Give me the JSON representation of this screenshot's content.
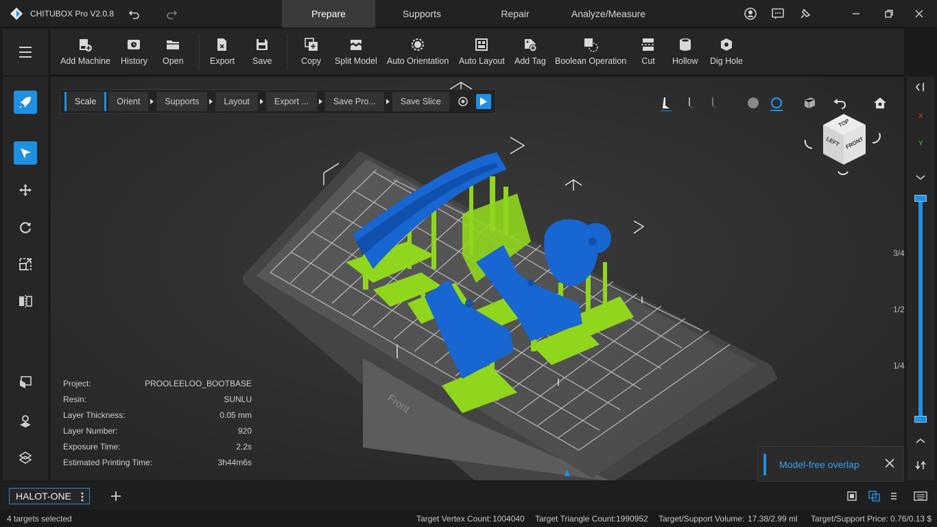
{
  "app": {
    "title": "CHITUBOX Pro V2.0.8",
    "logo_icon": "chitubox-logo-icon",
    "accent": "#1e8fe1"
  },
  "tabs": [
    {
      "label": "Prepare",
      "active": true
    },
    {
      "label": "Supports",
      "active": false
    },
    {
      "label": "Repair",
      "active": false
    },
    {
      "label": "Analyze/Measure",
      "active": false
    }
  ],
  "toolbar": [
    {
      "label": "Add Machine",
      "icon": "add-machine-icon"
    },
    {
      "label": "History",
      "icon": "history-icon"
    },
    {
      "label": "Open",
      "icon": "folder-open-icon"
    },
    {
      "label": "Export",
      "icon": "export-icon"
    },
    {
      "label": "Save",
      "icon": "save-icon"
    },
    {
      "label": "Copy",
      "icon": "copy-icon"
    },
    {
      "label": "Split Model",
      "icon": "split-model-icon"
    },
    {
      "label": "Auto Orientation",
      "icon": "auto-orientation-icon"
    },
    {
      "label": "Auto Layout",
      "icon": "auto-layout-icon"
    },
    {
      "label": "Add Tag",
      "icon": "add-tag-icon"
    },
    {
      "label": "Boolean Operation",
      "icon": "boolean-icon"
    },
    {
      "label": "Cut",
      "icon": "cut-icon"
    },
    {
      "label": "Hollow",
      "icon": "hollow-icon"
    },
    {
      "label": "Dig Hole",
      "icon": "dig-hole-icon"
    }
  ],
  "workflow": [
    "Scale",
    "Orient",
    "Supports",
    "Layout",
    "Export ...",
    "Save Pro...",
    "Save Slice"
  ],
  "info": {
    "project_label": "Project:",
    "project": "PROOLEELOO_BOOTBASE",
    "resin_label": "Resin:",
    "resin": "SUNLU",
    "layer_thickness_label": "Layer Thickness:",
    "layer_thickness": "0.05 mm",
    "layer_number_label": "Layer Number:",
    "layer_number": "920",
    "exposure_label": "Exposure Time:",
    "exposure": "2.2s",
    "print_time_label": "Estimated Printing Time:",
    "print_time": "3h44m6s"
  },
  "view_cube": {
    "top": "TOP",
    "left": "LEFT",
    "front": "FRONT"
  },
  "plate_label": "Front",
  "axis": {
    "x": "X",
    "y": "Y"
  },
  "slider": {
    "marks": [
      "3/4",
      "1/2",
      "1/4"
    ],
    "upper": 1.0,
    "lower": 0.0
  },
  "toast": {
    "text": "Model-free overlap"
  },
  "machine": {
    "name": "HALOT-ONE"
  },
  "status": {
    "selected": "4 targets selected",
    "vertex_label": "Target Vertex Count:",
    "vertex": "1004040",
    "triangle_label": "Target Triangle Count:",
    "triangle": "1990952",
    "volume_label": "Target/Support Volume:",
    "volume": "17.38/2.99 ml",
    "price_label": "Target/Support Price:",
    "price": "0.76/0.13 $"
  }
}
